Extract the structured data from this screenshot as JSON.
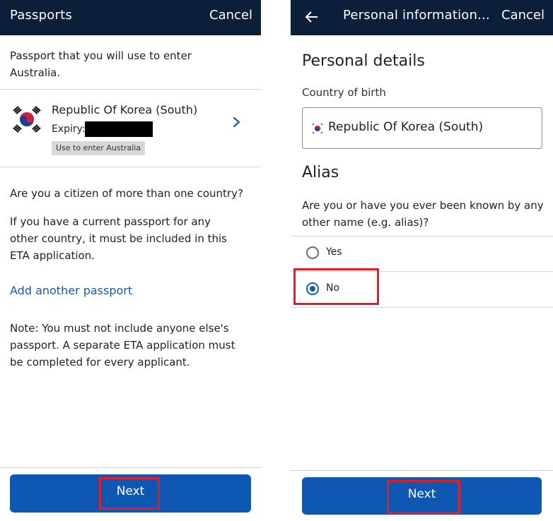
{
  "left": {
    "header": {
      "title": "Passports",
      "cancel_label": "Cancel"
    },
    "intro": "Passport that you will use to enter Australia.",
    "passport": {
      "country": "Republic Of Korea (South)",
      "expiry_label": "Expiry:",
      "tag": "Use to enter Australia",
      "flag_icon": "south-korea-flag-icon"
    },
    "question": "Are you a citizen of more than one country?",
    "info": "If you have a current passport for any other country, it must be included in this ETA application.",
    "add_link": "Add another passport",
    "note": "Note: You must not include anyone else's passport. A separate ETA application must be completed for every applicant.",
    "next_label": "Next"
  },
  "right": {
    "header": {
      "title": "Personal information...",
      "cancel_label": "Cancel",
      "back_icon": "back-arrow-icon"
    },
    "personal_details_heading": "Personal details",
    "country_of_birth_label": "Country of birth",
    "country_of_birth_value": "Republic Of Korea (South)",
    "alias_heading": "Alias",
    "alias_question": "Are you or have you ever been known by any other name (e.g. alias)?",
    "options": [
      {
        "label": "Yes",
        "selected": false
      },
      {
        "label": "No",
        "selected": true
      }
    ],
    "next_label": "Next"
  },
  "colors": {
    "header_bg": "#0b1f3b",
    "primary_button": "#0e57b2",
    "link": "#1a5aa6",
    "highlight": "#e11d2a"
  }
}
